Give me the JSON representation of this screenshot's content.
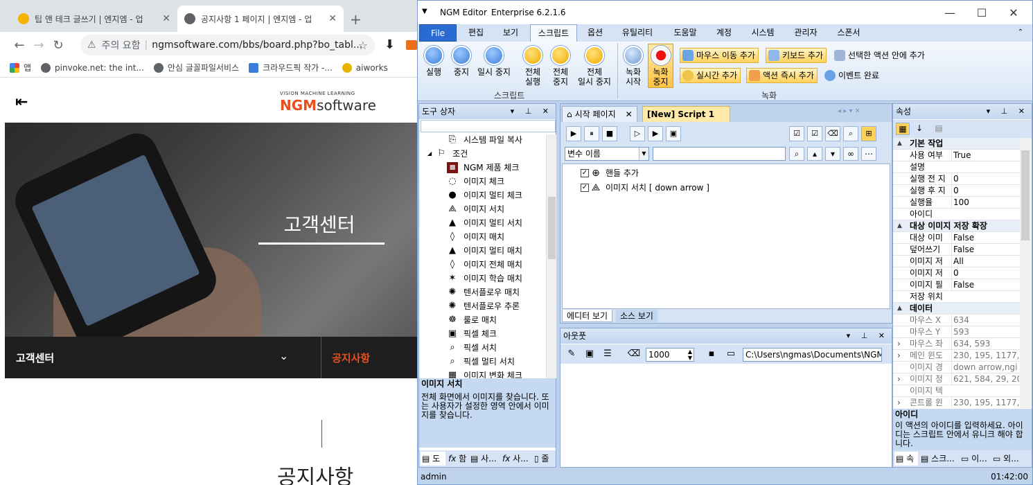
{
  "browser": {
    "tabs": [
      {
        "label": "팁 앤 테크 글쓰기 | 엔지엠 - 업",
        "active": false
      },
      {
        "label": "공지사항 1 페이지 | 엔지엠 - 업",
        "active": true
      }
    ],
    "address": {
      "security": "주의 요함",
      "url": "ngmsoftware.com/bbs/board.php?bo_tabl..."
    },
    "bookmarks": [
      "앱",
      "pinvoke.net: the int...",
      "안심 글꼴파일서비스",
      "크라우드픽 작가 -...",
      "aiworks"
    ],
    "site": {
      "logo_sub": "VISION MACHINE LEARNING",
      "logo_main_a": "NGM",
      "logo_main_b": "software",
      "hero_title": "고객센터",
      "subnav_left": "고객센터",
      "subnav_right": "공지사항",
      "page_title": "공지사항"
    }
  },
  "editor": {
    "title": "NGM Editor",
    "edition": "Enterprise 6.2.1.6",
    "ribbon_tabs": [
      "File",
      "편집",
      "보기",
      "스크립트",
      "옵션",
      "유틸리티",
      "도움말",
      "계정",
      "시스템",
      "관리자",
      "스폰서"
    ],
    "ribbon": {
      "script_group": "스크립트",
      "record_group": "녹화",
      "buttons": [
        [
          "실행"
        ],
        [
          "중지"
        ],
        [
          "일시 중지"
        ],
        [
          "전체",
          "실행"
        ],
        [
          "전체",
          "중지"
        ],
        [
          "전체",
          "일시 중지"
        ],
        [
          "녹화",
          "시작"
        ],
        [
          "녹화",
          "중지"
        ]
      ],
      "small": [
        "마우스 이동 추가",
        "키보드 추가",
        "선택한 액션 안에 추가",
        "실시간 추가",
        "액션 즉시 추가",
        "이벤트 완료"
      ]
    },
    "toolbox": {
      "title": "도구 상자",
      "items": [
        "시스템 파일 복사",
        "조건",
        "NGM 제품 체크",
        "이미지 체크",
        "이미지 멀티 체크",
        "이미지 서치",
        "이미지 멀티 서치",
        "이미지 매치",
        "이미지 멀티 매치",
        "이미지 전체 매치",
        "이미지 학습 매치",
        "텐서플로우 매치",
        "텐서플로우 추론",
        "룰로 매치",
        "픽셀 체크",
        "픽셀 서치",
        "픽셀 멀티 서치",
        "이미지 변화 체크"
      ],
      "desc_title": "이미지 서치",
      "desc_text": "전체 화면에서 이미지를 찾습니다. 또는 사용자가 설정한 영역 안에서 이미지를 찾습니다.",
      "bottom_tabs": [
        "도",
        "함",
        "사...",
        "사...",
        "줄"
      ]
    },
    "doc_tabs": [
      "시작 페이지",
      "[New] Script 1"
    ],
    "var_combo": "변수 이름",
    "script_lines": [
      "핸들 추가",
      "이미지 서치 [ down arrow ]"
    ],
    "view_tabs": [
      "에디터 보기",
      "소스 보기"
    ],
    "output": {
      "title": "아웃풋",
      "count": "1000",
      "path": "C:\\Users\\ngmas\\Documents\\NGM6\\"
    },
    "props": {
      "title": "속성",
      "rows": [
        {
          "cat": "기본 작업"
        },
        {
          "k": "사용 여부",
          "v": "True"
        },
        {
          "k": "설명",
          "v": ""
        },
        {
          "k": "실행 전 지",
          "v": "0"
        },
        {
          "k": "실행 후 지",
          "v": "0"
        },
        {
          "k": "실행율",
          "v": "100"
        },
        {
          "k": "아이디",
          "v": ""
        },
        {
          "cat": "대상 이미지 저장 확장"
        },
        {
          "k": "대상 이미",
          "v": "False"
        },
        {
          "k": "덮어쓰기",
          "v": "False"
        },
        {
          "k": "이미지 저",
          "v": "All"
        },
        {
          "k": "이미지 저",
          "v": "0"
        },
        {
          "k": "이미지 필",
          "v": "False"
        },
        {
          "k": "저장 위치",
          "v": ""
        },
        {
          "cat": "데이터"
        },
        {
          "k": "마우스 X",
          "v": "634",
          "gray": true
        },
        {
          "k": "마우스 Y",
          "v": "593",
          "gray": true
        },
        {
          "k": "마우스 좌",
          "v": "634, 593",
          "gray": true,
          "exp": true
        },
        {
          "k": "메인 윈도",
          "v": "230, 195, 1177, 10",
          "gray": true,
          "exp": true
        },
        {
          "k": "이미지 경",
          "v": "down arrow,ngi",
          "gray": true
        },
        {
          "k": "이미지 정",
          "v": "621, 584, 29, 20",
          "gray": true,
          "exp": true
        },
        {
          "k": "이미지 텍",
          "v": "",
          "gray": true
        },
        {
          "k": "콘트롤 윈",
          "v": "230, 195, 1177, 10",
          "gray": true,
          "exp": true
        }
      ],
      "desc_title": "아이디",
      "desc_text": "이 액션의 아이디를 입력하세요. 아이디는 스크립트 안에서 유니크 해야 합니다.",
      "bottom_tabs": [
        "속",
        "스크...",
        "이...",
        "외..."
      ]
    },
    "status": {
      "user": "admin",
      "time": "01:42:00"
    }
  }
}
